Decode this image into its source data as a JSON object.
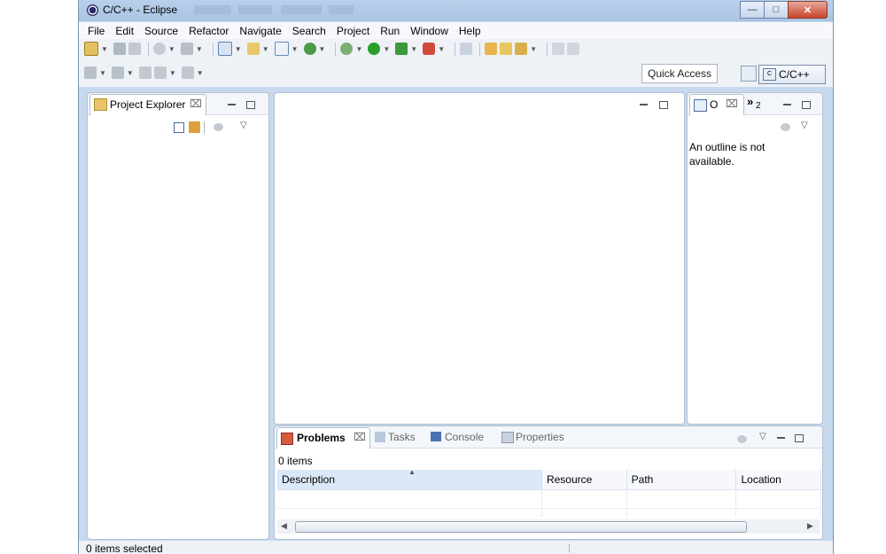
{
  "window": {
    "title": "C/C++ - Eclipse"
  },
  "menu": [
    "File",
    "Edit",
    "Source",
    "Refactor",
    "Navigate",
    "Search",
    "Project",
    "Run",
    "Window",
    "Help"
  ],
  "toolbar": {
    "quick_access": "Quick Access",
    "perspective_label": "C/C++"
  },
  "project_explorer": {
    "tab_label": "Project Explorer"
  },
  "outline": {
    "tab_label": "O",
    "overflow_count": "2",
    "message": "An outline is not available."
  },
  "problems": {
    "tabs": [
      "Problems",
      "Tasks",
      "Console",
      "Properties"
    ],
    "count_text": "0 items",
    "columns": [
      "Description",
      "Resource",
      "Path",
      "Location"
    ]
  },
  "status": {
    "text": "0 items selected"
  },
  "colors": {
    "frame": "#c7d9ee",
    "border": "#b3c1d3",
    "selection": "#dbe8f7"
  }
}
